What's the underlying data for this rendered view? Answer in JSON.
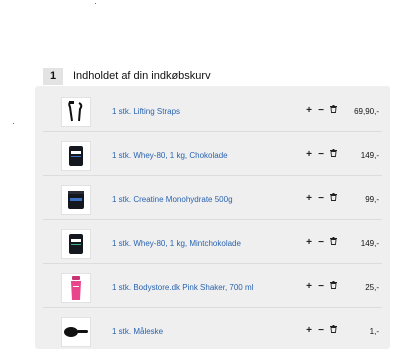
{
  "cart": {
    "step_number": "1",
    "title": "Indholdet af din indkøbskurv",
    "controls": {
      "increase": "+",
      "decrease": "−"
    },
    "items": [
      {
        "name": "1 stk. Lifting Straps",
        "price": "69,90,-",
        "icon": "lifting-straps-icon"
      },
      {
        "name": "1 stk. Whey-80, 1 kg, Chokolade",
        "price": "149,-",
        "icon": "protein-bag-icon"
      },
      {
        "name": "1 stk. Creatine Monohydrate 500g",
        "price": "99,-",
        "icon": "creatine-jar-icon"
      },
      {
        "name": "1 stk. Whey-80, 1 kg, Mintchokolade",
        "price": "149,-",
        "icon": "protein-bag-icon"
      },
      {
        "name": "1 stk. Bodystore.dk Pink Shaker, 700 ml",
        "price": "25,-",
        "icon": "pink-shaker-icon"
      },
      {
        "name": "1 stk. Måleske",
        "price": "1,-",
        "icon": "measuring-scoop-icon"
      }
    ]
  },
  "colors": {
    "link": "#2a64b0",
    "panel": "#efefef",
    "badge": "#e3e3e3",
    "shaker": "#e8458b"
  }
}
